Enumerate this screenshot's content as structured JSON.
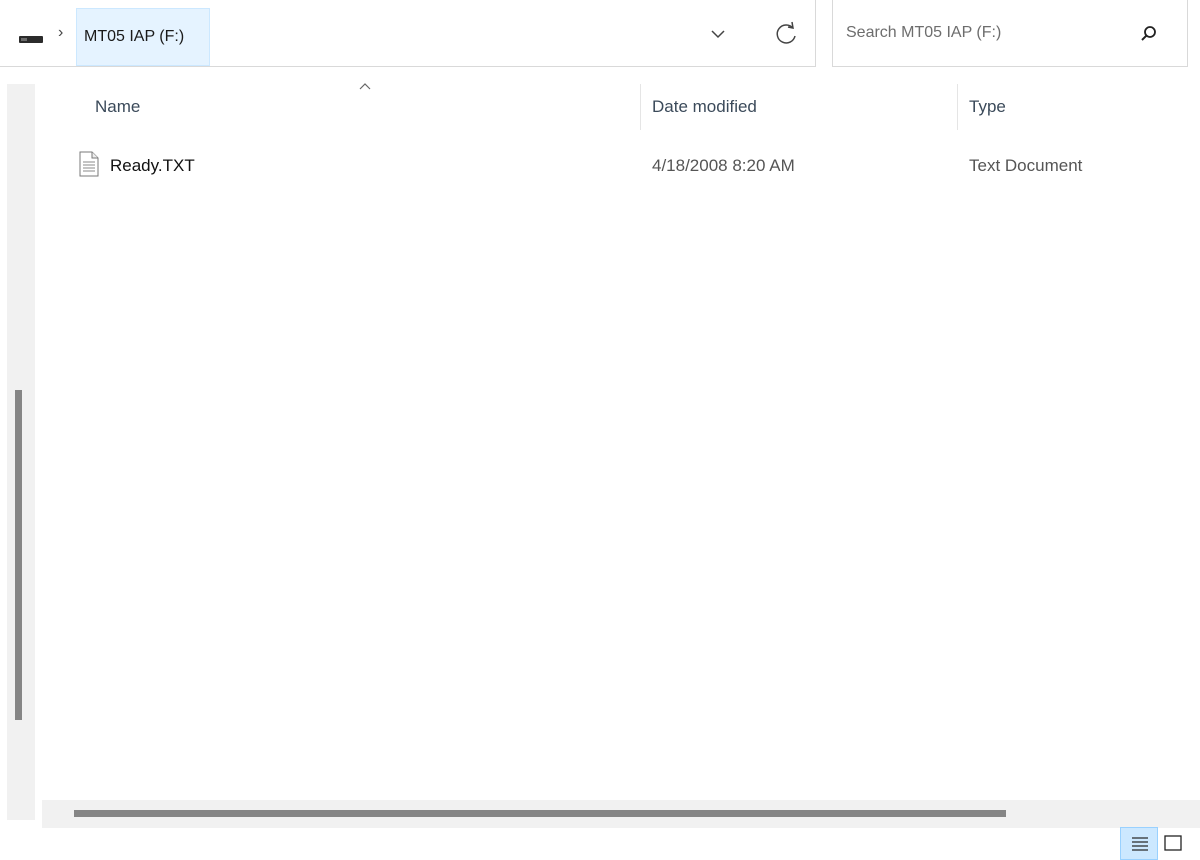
{
  "address_bar": {
    "drive_icon": "drive-icon",
    "separator": "›",
    "current_location": "MT05 IAP (F:)",
    "dropdown_icon": "chevron-down-icon",
    "refresh_icon": "refresh-icon"
  },
  "search": {
    "placeholder": "Search MT05 IAP (F:)",
    "icon": "search-icon"
  },
  "columns": {
    "name": "Name",
    "date_modified": "Date modified",
    "type": "Type",
    "sort_indicator": "sort-ascending-icon"
  },
  "files": [
    {
      "name": "Ready.TXT",
      "date_modified": "4/18/2008 8:20 AM",
      "type": "Text Document",
      "icon": "text-file-icon"
    }
  ],
  "view_toggles": {
    "details": "details-view-icon",
    "tiles": "large-icons-view-icon",
    "active": "details"
  },
  "colors": {
    "selection_bg": "#cce8ff",
    "breadcrumb_hover": "#e5f3ff",
    "scroll_thumb": "#858585"
  }
}
